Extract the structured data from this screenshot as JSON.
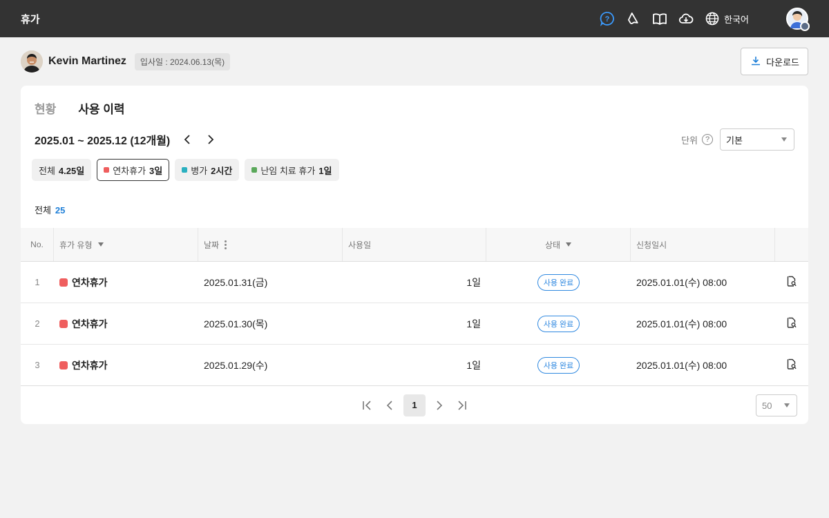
{
  "header": {
    "title": "휴가",
    "language": "한국어",
    "icons": [
      "help-icon",
      "megaphone-icon",
      "book-icon",
      "cloud-download-icon",
      "globe-icon"
    ]
  },
  "user": {
    "name": "Kevin Martinez",
    "join_date": "입사일 : 2024.06.13(목)",
    "download_label": "다운로드"
  },
  "tabs": [
    {
      "label": "현황",
      "active": false
    },
    {
      "label": "사용 이력",
      "active": true
    }
  ],
  "period": {
    "label": "2025.01 ~ 2025.12 (12개월)",
    "unit_label": "단위",
    "unit_help": "?",
    "unit_value": "기본"
  },
  "chips": [
    {
      "name": "전체",
      "value": "4.25일",
      "color": null,
      "active": false
    },
    {
      "name": "연차휴가",
      "value": "3일",
      "color": "#ef5e5e",
      "active": true
    },
    {
      "name": "병가",
      "value": "2시간",
      "color": "#2bb0c0",
      "active": false
    },
    {
      "name": "난임 치료 휴가",
      "value": "1일",
      "color": "#5aa85a",
      "active": false
    }
  ],
  "total": {
    "label": "전체",
    "count": "25"
  },
  "table": {
    "columns": [
      "No.",
      "휴가 유형",
      "날짜",
      "사용일",
      "상태",
      "신청일시"
    ],
    "rows": [
      {
        "no": "1",
        "type": "연차휴가",
        "date": "2025.01.31(금)",
        "days": "1일",
        "status": "사용 완료",
        "requested": "2025.01.01(수) 08:00"
      },
      {
        "no": "2",
        "type": "연차휴가",
        "date": "2025.01.30(목)",
        "days": "1일",
        "status": "사용 완료",
        "requested": "2025.01.01(수) 08:00"
      },
      {
        "no": "3",
        "type": "연차휴가",
        "date": "2025.01.29(수)",
        "days": "1일",
        "status": "사용 완료",
        "requested": "2025.01.01(수) 08:00"
      }
    ]
  },
  "pagination": {
    "current": "1",
    "page_size": "50"
  },
  "colors": {
    "topbar": "#333333",
    "accent": "#2e88e0",
    "annual_leave": "#ef5e5e"
  }
}
